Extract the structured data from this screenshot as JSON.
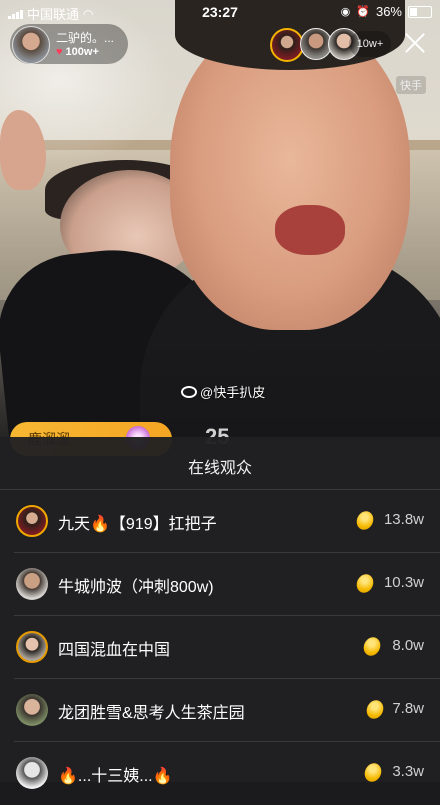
{
  "status_bar": {
    "carrier": "中国联通",
    "time": "23:27",
    "battery": "36%"
  },
  "host": {
    "name": "二驴的。...",
    "likes": "100w+"
  },
  "viewer_count": "10w+",
  "watermark_brand": "快手",
  "watermark_weibo": "@快手扒皮",
  "gift_banner": {
    "text": "鹿溜溜",
    "count": "25"
  },
  "online_panel": {
    "title": "在线观众",
    "viewers": [
      {
        "name": "九天🔥【919】扛把子",
        "value": "13.8w"
      },
      {
        "name": "牛城帅波（冲刺800w)",
        "value": "10.3w"
      },
      {
        "name": "四国混血在中国",
        "value": "8.0w"
      },
      {
        "name": "龙团胜雪&思考人生茶庄园",
        "value": "7.8w"
      },
      {
        "name": "🔥...十三姨...🔥",
        "value": "3.3w"
      }
    ]
  },
  "colors": {
    "coin": "#f5b900",
    "heart": "#ff3b5c",
    "gift": "#f5a623"
  }
}
